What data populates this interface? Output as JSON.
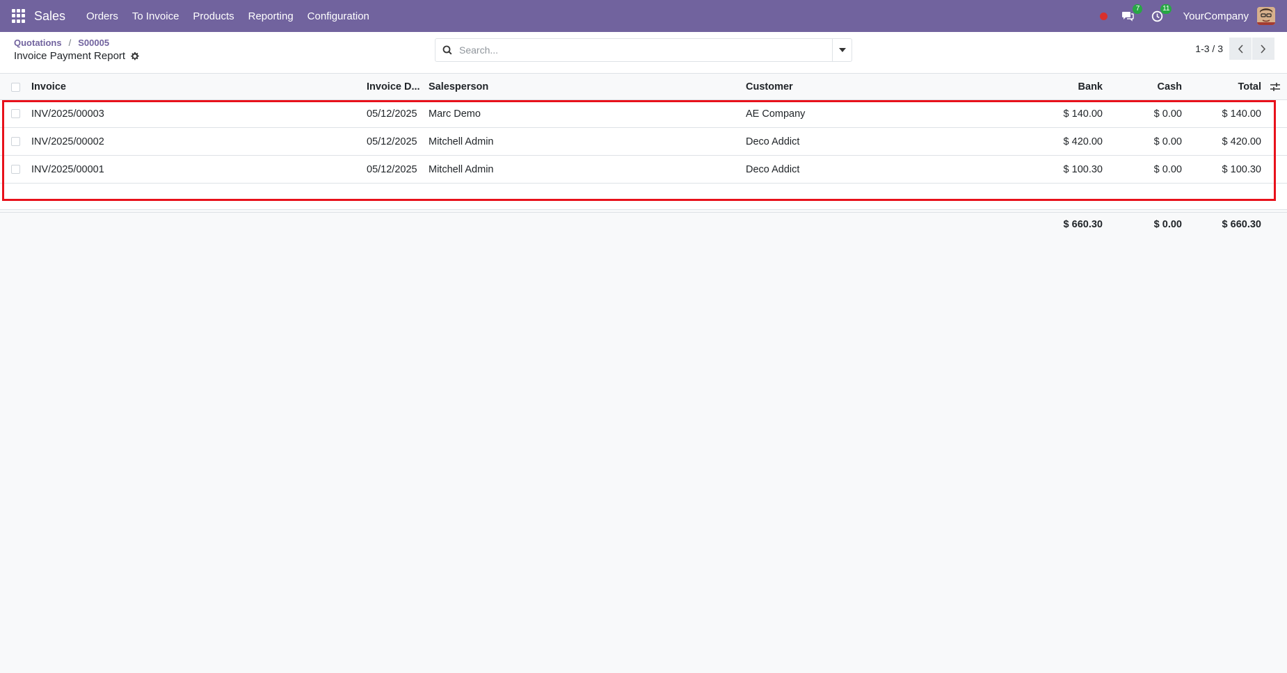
{
  "navbar": {
    "app_name": "Sales",
    "menu": [
      "Orders",
      "To Invoice",
      "Products",
      "Reporting",
      "Configuration"
    ],
    "messages_count": "7",
    "activities_count": "11",
    "company": "YourCompany",
    "accent": "#71639e"
  },
  "control_panel": {
    "breadcrumb": [
      "Quotations",
      "S00005"
    ],
    "title": "Invoice Payment Report",
    "search_placeholder": "Search...",
    "pager": "1-3 / 3"
  },
  "table": {
    "columns": [
      "Invoice",
      "Invoice D...",
      "Salesperson",
      "Customer",
      "Bank",
      "Cash",
      "Total"
    ],
    "rows": [
      {
        "invoice": "INV/2025/00003",
        "date": "05/12/2025",
        "salesperson": "Marc Demo",
        "customer": "AE Company",
        "bank": "$ 140.00",
        "cash": "$ 0.00",
        "total": "$ 140.00"
      },
      {
        "invoice": "INV/2025/00002",
        "date": "05/12/2025",
        "salesperson": "Mitchell Admin",
        "customer": "Deco Addict",
        "bank": "$ 420.00",
        "cash": "$ 0.00",
        "total": "$ 420.00"
      },
      {
        "invoice": "INV/2025/00001",
        "date": "05/12/2025",
        "salesperson": "Mitchell Admin",
        "customer": "Deco Addict",
        "bank": "$ 100.30",
        "cash": "$ 0.00",
        "total": "$ 100.30"
      }
    ],
    "totals": {
      "bank": "$ 660.30",
      "cash": "$ 0.00",
      "total": "$ 660.30"
    }
  },
  "highlight_color": "#e8111b"
}
